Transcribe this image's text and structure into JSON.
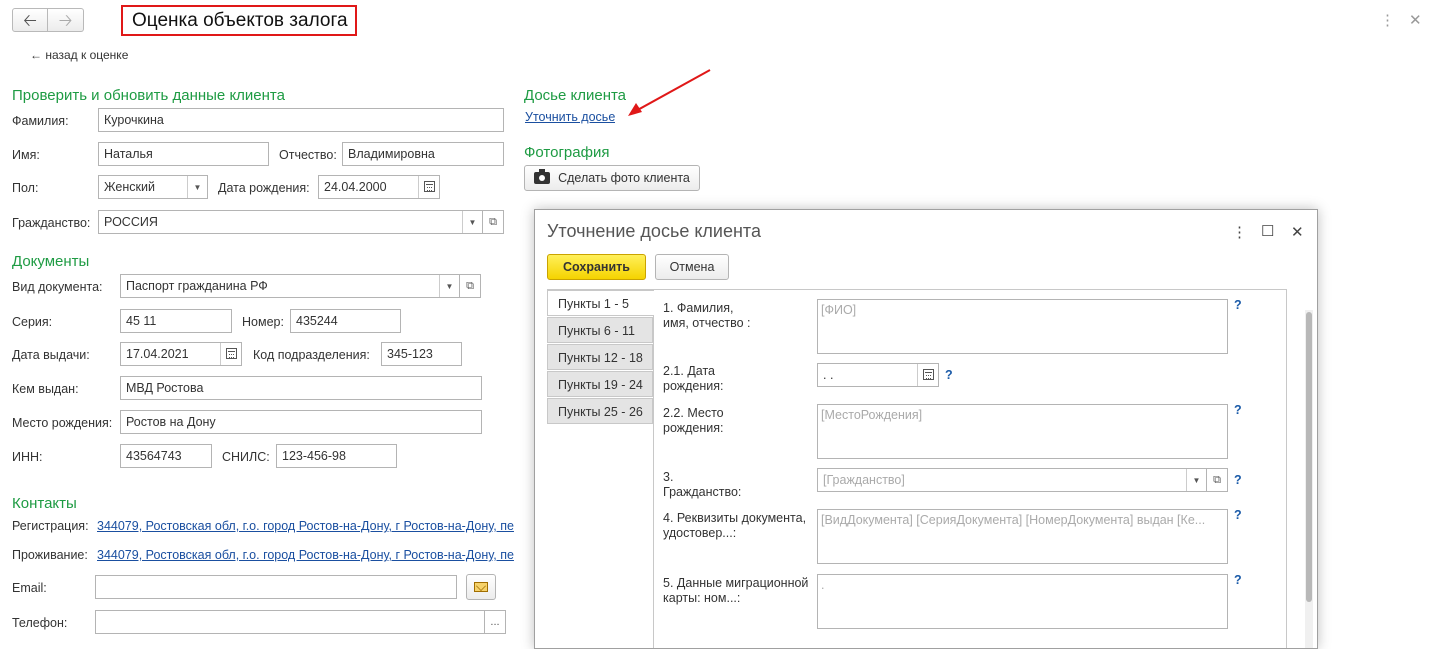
{
  "header": {
    "back_icon": "arrow-left-icon",
    "forward_icon": "arrow-right-icon",
    "title": "Оценка объектов залога",
    "more_icon": "kebab-menu-icon",
    "close_icon": "close-icon"
  },
  "back_link": "← назад к оценке",
  "client_section": {
    "title": "Проверить и обновить данные клиента",
    "surname_label": "Фамилия:",
    "surname_value": "Курочкина",
    "name_label": "Имя:",
    "name_value": "Наталья",
    "patronymic_label": "Отчество:",
    "patronymic_value": "Владимировна",
    "gender_label": "Пол:",
    "gender_value": "Женский",
    "birthdate_label": "Дата рождения:",
    "birthdate_value": "24.04.2000",
    "citizenship_label": "Гражданство:",
    "citizenship_value": "РОССИЯ"
  },
  "documents_section": {
    "title": "Документы",
    "doctype_label": "Вид документа:",
    "doctype_value": "Паспорт гражданина РФ",
    "series_label": "Серия:",
    "series_value": "45 11",
    "number_label": "Номер:",
    "number_value": "435244",
    "issue_date_label": "Дата выдачи:",
    "issue_date_value": "17.04.2021",
    "dept_code_label": "Код подразделения:",
    "dept_code_value": "345-123",
    "issued_by_label": "Кем выдан:",
    "issued_by_value": "МВД Ростова",
    "birthplace_label": "Место рождения:",
    "birthplace_value": "Ростов на Дону",
    "inn_label": "ИНН:",
    "inn_value": "43564743",
    "snils_label": "СНИЛС:",
    "snils_value": "123-456-98"
  },
  "contacts_section": {
    "title": "Контакты",
    "registration_label": "Регистрация:",
    "registration_value": "344079, Ростовская обл, г.о. город Ростов-на-Дону, г Ростов-на-Дону, пе",
    "residence_label": "Проживание:",
    "residence_value": "344079, Ростовская обл, г.о. город Ростов-на-Дону, г Ростов-на-Дону, пе",
    "email_label": "Email:",
    "email_value": "",
    "phone_label": "Телефон:",
    "phone_value": "",
    "phone_more": "..."
  },
  "dossier_section": {
    "title": "Досье клиента",
    "clarify_link": "Уточнить досье"
  },
  "photo_section": {
    "title": "Фотография",
    "take_photo_button": "Сделать фото клиента"
  },
  "annotation": {
    "arrow_color": "#e01818"
  },
  "modal": {
    "title": "Уточнение досье клиента",
    "save_button": "Сохранить",
    "cancel_button": "Отмена",
    "tabs": [
      "Пункты 1 - 5",
      "Пункты 6 - 11",
      "Пункты 12 - 18",
      "Пункты 19 - 24",
      "Пункты 25 - 26"
    ],
    "fields": {
      "fio_label": "1. Фамилия,\nимя, отчество :",
      "fio_placeholder": "[ФИО]",
      "dob_label": "2.1. Дата\nрождения:",
      "dob_value": " .  .",
      "birthplace_label": "2.2. Место\nрождения:",
      "birthplace_placeholder": "[МестоРождения]",
      "citizenship_label": "3.\nГражданство:",
      "citizenship_placeholder": "[Гражданство]",
      "docs_label": "4. Реквизиты документа,\nудостовер...:",
      "docs_placeholder": "[ВидДокумента] [СерияДокумента] [НомерДокумента] выдан [Ке...",
      "migration_label": "5. Данные миграционной\nкарты: ном...:",
      "migration_value": ".",
      "help": "?"
    }
  },
  "colors": {
    "section_green": "#1e9b43",
    "link_blue": "#1a4fa0",
    "save_yellow": "#f5d300",
    "highlight_red": "#e01818"
  }
}
